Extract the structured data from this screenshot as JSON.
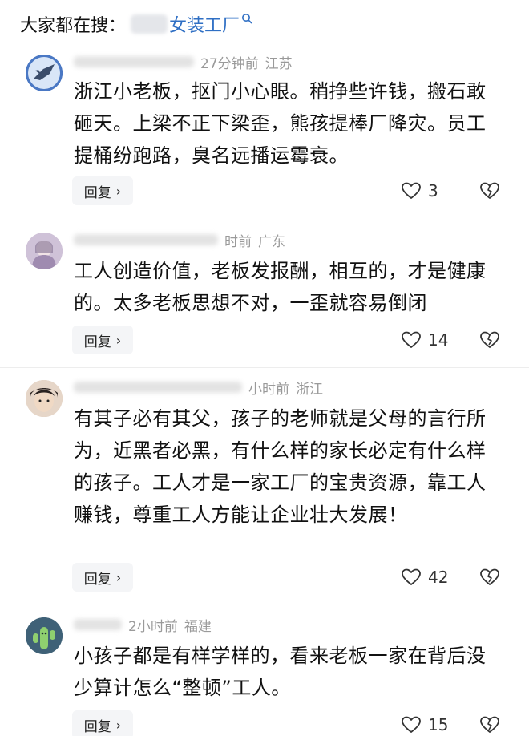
{
  "search": {
    "prefix": "大家都在搜：",
    "term": "女装工厂"
  },
  "comments": [
    {
      "time": "27分钟前",
      "location": "江苏",
      "text_lines": [
        "浙江小老板，抠门小心眼。稍挣些许钱，搬石敢",
        "砸天。上梁不正下梁歪，熊孩提棒厂降灾。员工",
        "提桶纷跑路，臭名远播运霉衰。"
      ],
      "reply_label": "回复",
      "likes": "3"
    },
    {
      "time": "时前",
      "location": "广东",
      "text_lines": [
        "工人创造价值，老板发报酬，相互的，才是健康",
        "的。太多老板思想不对，一歪就容易倒闭"
      ],
      "reply_label": "回复",
      "likes": "14"
    },
    {
      "time": "小时前",
      "location": "浙江",
      "text_lines": [
        "有其子必有其父，孩子的老师就是父母的言行所",
        "为，近黑者必黑，有什么样的家长必定有什么样",
        "的孩子。工人才是一家工厂的宝贵资源，靠工人",
        "赚钱，尊重工人方能让企业壮大发展！"
      ],
      "reply_label": "回复",
      "likes": "42"
    },
    {
      "time": "2小时前",
      "location": "福建",
      "text_lines": [
        "小孩子都是有样学样的，看来老板一家在背后没",
        "少算计怎么“整顿”工人。"
      ],
      "reply_label": "回复",
      "likes": "15"
    }
  ],
  "icons": {
    "search": "search-icon",
    "like": "heart-outline-icon",
    "dislike": "broken-heart-icon",
    "chevron": "chevron-right-icon"
  }
}
